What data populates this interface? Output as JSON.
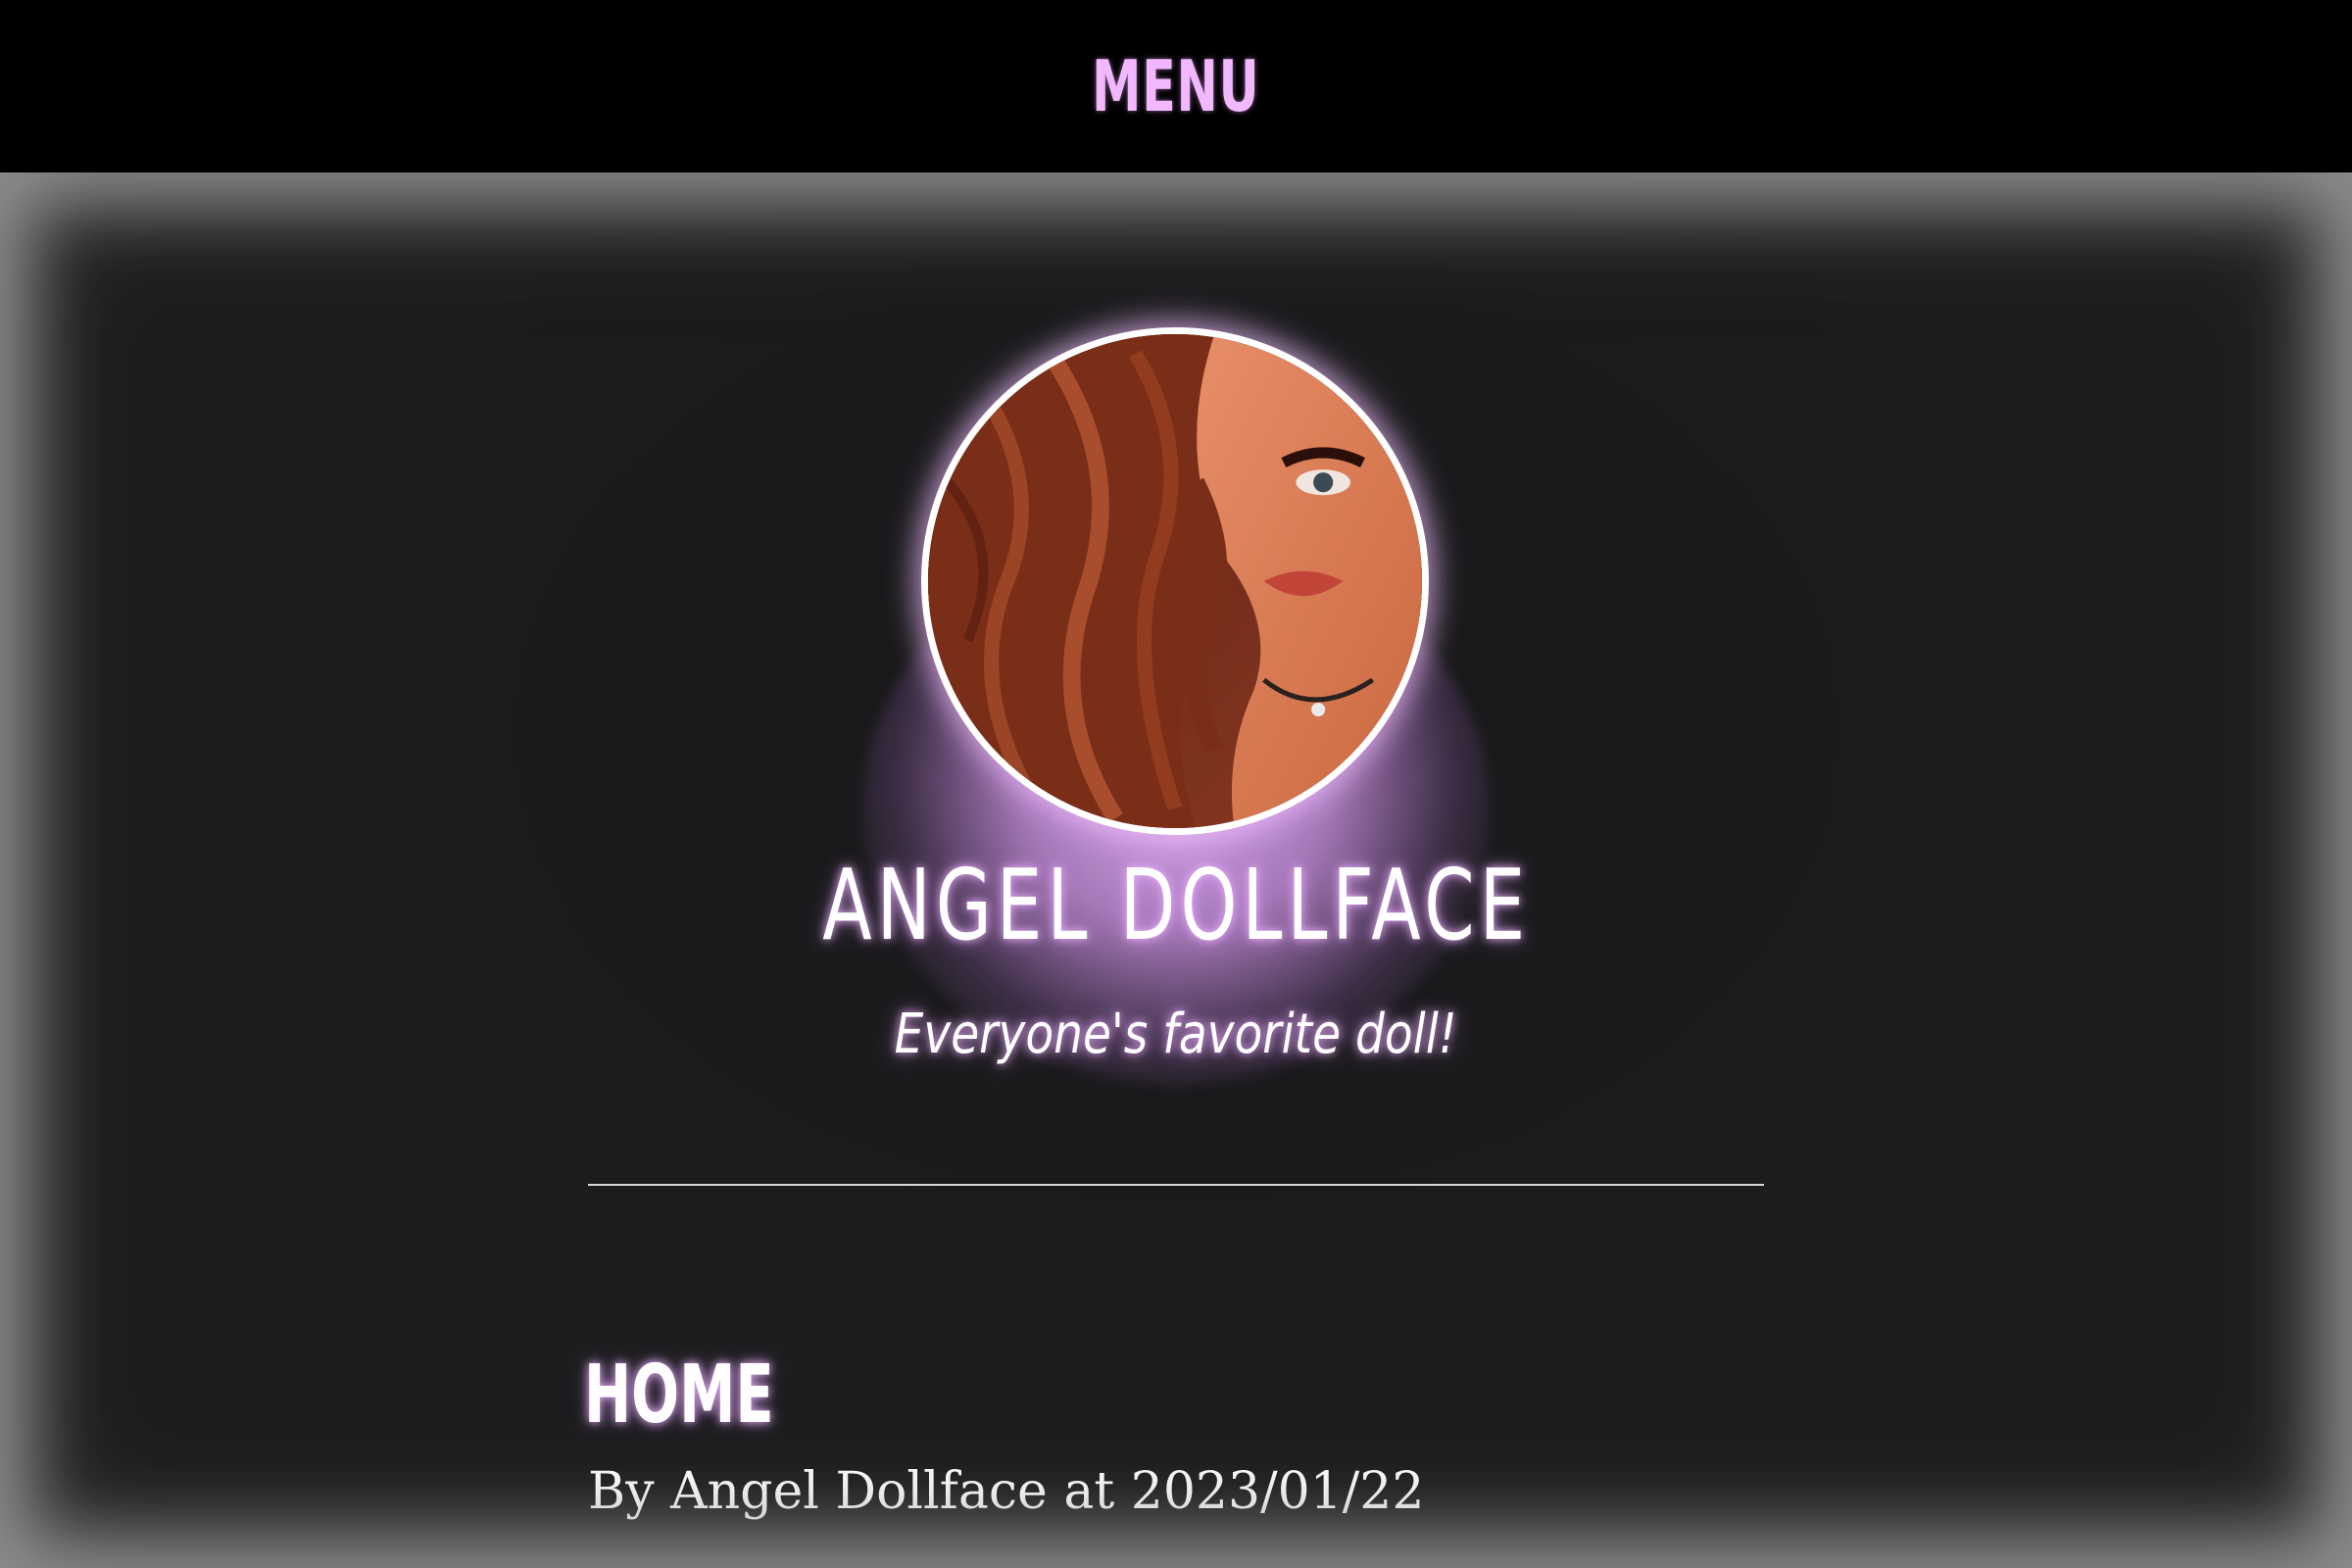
{
  "header": {
    "menu_label": "MENU"
  },
  "profile": {
    "name": "ANGEL DOLLFACE",
    "tagline": "Everyone's favorite doll!"
  },
  "post": {
    "title": "HOME",
    "meta": "By Angel Dollface at 2023/01/22"
  },
  "colors": {
    "accent": "#f2b8ff",
    "background": "#1d1d1f",
    "header_bg": "#000000",
    "glow": "#e6b4fa"
  }
}
